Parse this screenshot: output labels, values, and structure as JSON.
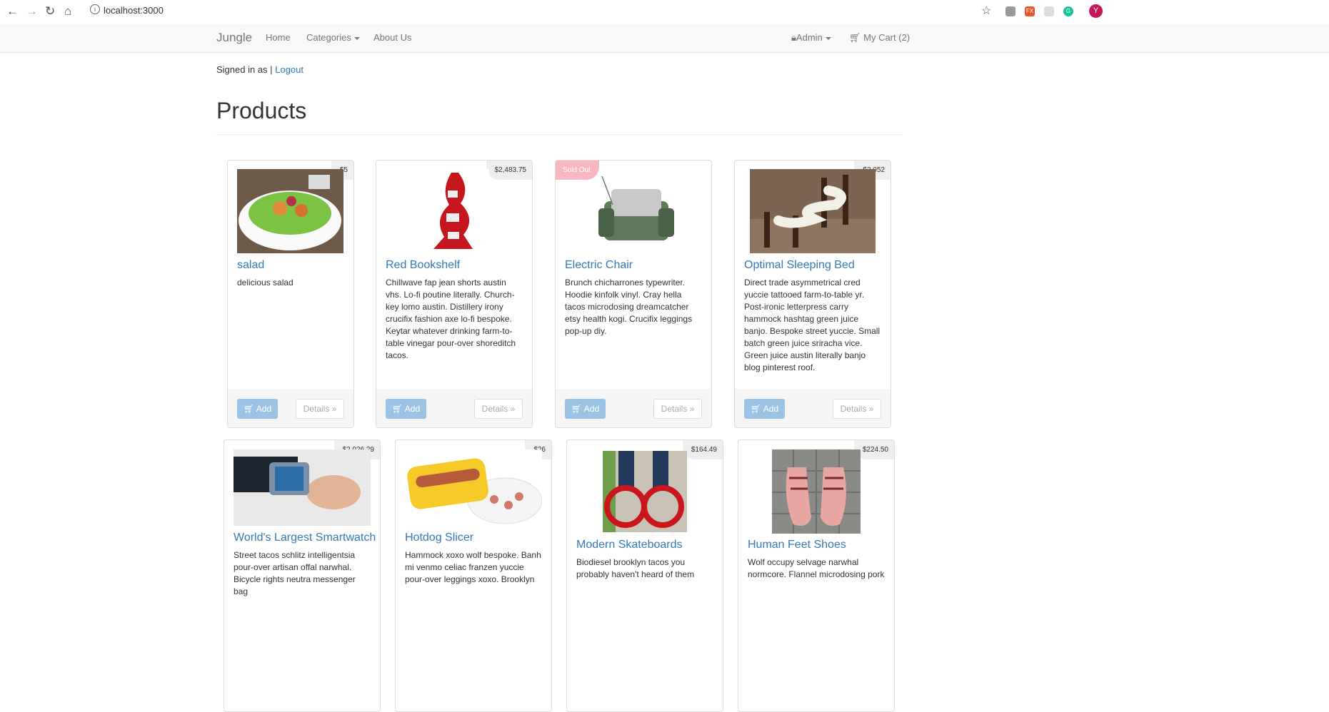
{
  "browser": {
    "url": "localhost:3000",
    "back_icon": "←",
    "forward_icon": "→",
    "reload_icon": "↻",
    "home_icon": "⌂",
    "star_icon": "☆",
    "ext_fx": "FX",
    "ext_g": "G",
    "avatar_letter": "Y"
  },
  "navbar": {
    "brand": "Jungle",
    "home": "Home",
    "categories": "Categories",
    "about": "About Us",
    "admin": "Admin",
    "cart": "My Cart (2)"
  },
  "session": {
    "signed_in": "Signed in as |",
    "logout": "Logout"
  },
  "page": {
    "title": "Products"
  },
  "buttons": {
    "add": "Add",
    "details": "Details »"
  },
  "products": [
    {
      "name": "salad",
      "price": "$5",
      "description": "delicious salad"
    },
    {
      "name": "Red Bookshelf",
      "price": "$2,483.75",
      "description": "Chillwave fap jean shorts austin vhs. Lo-fi poutine literally. Church-key lomo austin. Distillery irony crucifix fashion axe lo-fi bespoke. Keytar whatever drinking farm-to-table vinegar pour-over shoreditch tacos."
    },
    {
      "name": "Electric Chair",
      "badge": "Sold Out",
      "description": "Brunch chicharrones typewriter. Hoodie kinfolk vinyl. Cray hella tacos microdosing dreamcatcher etsy health kogi. Crucifix leggings pop-up diy."
    },
    {
      "name": "Optimal Sleeping Bed",
      "price": "$3,052",
      "description": "Direct trade asymmetrical cred yuccie tattooed farm-to-table yr. Post-ironic letterpress carry hammock hashtag green juice banjo. Bespoke street yuccie. Small batch green juice sriracha vice. Green juice austin literally banjo blog pinterest roof."
    },
    {
      "name": "World's Largest Smartwatch",
      "price": "$2,026.29",
      "description": "Street tacos schlitz intelligentsia pour-over artisan offal narwhal. Bicycle rights neutra messenger bag"
    },
    {
      "name": "Hotdog Slicer",
      "price": "$26",
      "description": "Hammock xoxo wolf bespoke. Banh mi venmo celiac franzen yuccie pour-over leggings xoxo. Brooklyn"
    },
    {
      "name": "Modern Skateboards",
      "price": "$164.49",
      "description": "Biodiesel brooklyn tacos you probably haven't heard of them"
    },
    {
      "name": "Human Feet Shoes",
      "price": "$224.50",
      "description": "Wolf occupy selvage narwhal normcore. Flannel microdosing pork"
    }
  ]
}
